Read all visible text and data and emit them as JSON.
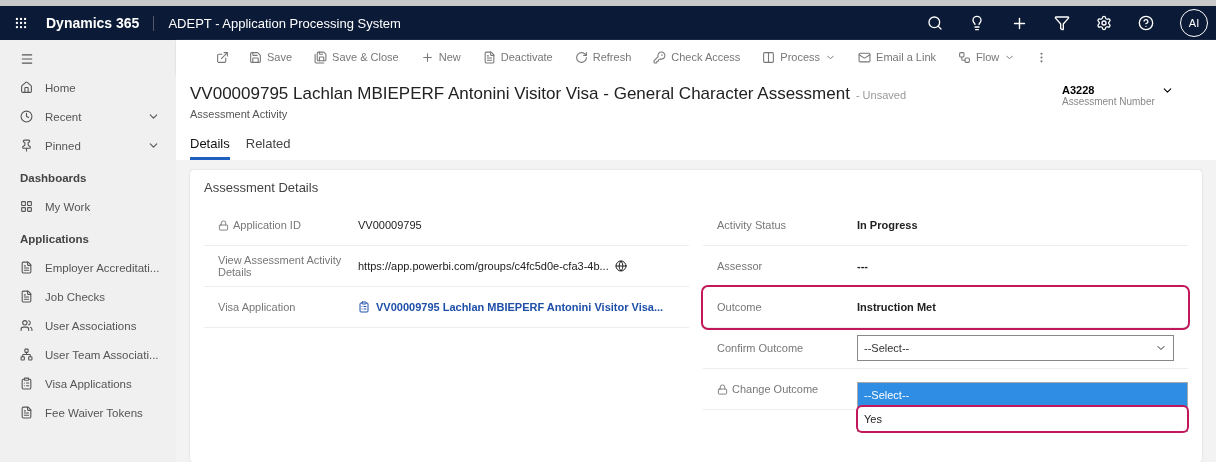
{
  "app_bar": {
    "product": "Dynamics 365",
    "app_name": "ADEPT - Application Processing System",
    "avatar": "AI"
  },
  "sidebar": {
    "items": [
      {
        "kind": "item",
        "label": "Home",
        "expandable": false
      },
      {
        "kind": "item",
        "label": "Recent",
        "expandable": true
      },
      {
        "kind": "item",
        "label": "Pinned",
        "expandable": true
      },
      {
        "kind": "heading",
        "label": "Dashboards"
      },
      {
        "kind": "item",
        "label": "My Work",
        "expandable": false
      },
      {
        "kind": "heading",
        "label": "Applications"
      },
      {
        "kind": "item",
        "label": "Employer Accreditati...",
        "expandable": false
      },
      {
        "kind": "item",
        "label": "Job Checks",
        "expandable": false
      },
      {
        "kind": "item",
        "label": "User Associations",
        "expandable": false
      },
      {
        "kind": "item",
        "label": "User Team Associati...",
        "expandable": false
      },
      {
        "kind": "item",
        "label": "Visa Applications",
        "expandable": false
      },
      {
        "kind": "item",
        "label": "Fee Waiver Tokens",
        "expandable": false
      }
    ]
  },
  "command_bar": [
    {
      "kind": "icon"
    },
    {
      "kind": "button",
      "label": "Save",
      "menu": false
    },
    {
      "kind": "button",
      "label": "Save & Close",
      "menu": false
    },
    {
      "kind": "button",
      "label": "New",
      "menu": false
    },
    {
      "kind": "button",
      "label": "Deactivate",
      "menu": false
    },
    {
      "kind": "button",
      "label": "Refresh",
      "menu": false
    },
    {
      "kind": "button",
      "label": "Check Access",
      "menu": false
    },
    {
      "kind": "button",
      "label": "Process",
      "menu": true
    },
    {
      "kind": "button",
      "label": "Email a Link",
      "menu": false
    },
    {
      "kind": "button",
      "label": "Flow",
      "menu": true
    },
    {
      "kind": "icon"
    }
  ],
  "record": {
    "title": "VV00009795 Lachlan MBIEPERF Antonini Visitor Visa - General Character Assessment",
    "save_state": "- Unsaved",
    "entity": "Assessment Activity",
    "header_value": "A3228",
    "header_label": "Assessment Number"
  },
  "tabs": [
    {
      "label": "Details",
      "selected": true
    },
    {
      "label": "Related",
      "selected": false
    }
  ],
  "section": {
    "title": "Assessment Details",
    "left_fields": [
      {
        "kind": "text",
        "label": "Application ID",
        "value": "VV00009795",
        "locked": true
      },
      {
        "kind": "url",
        "label": "View Assessment Activity Details",
        "value": "https://app.powerbi.com/groups/c4fc5d0e-cfa3-4b...",
        "locked": false
      },
      {
        "kind": "lookup",
        "label": "Visa Application",
        "value": "VV00009795 Lachlan MBIEPERF Antonini Visitor Visa...",
        "locked": false
      }
    ],
    "right_fields": [
      {
        "kind": "text",
        "label": "Activity Status",
        "value": "In Progress",
        "locked": false,
        "highlighted": false
      },
      {
        "kind": "text",
        "label": "Assessor",
        "value": "---",
        "locked": false,
        "highlighted": false
      },
      {
        "kind": "text",
        "label": "Outcome",
        "value": "Instruction Met",
        "locked": false,
        "highlighted": true
      },
      {
        "kind": "select",
        "label": "Confirm Outcome",
        "value": "--Select--",
        "locked": false,
        "highlighted": false,
        "options": [
          {
            "label": "--Select--",
            "selected": true,
            "highlighted": false
          },
          {
            "label": "Yes",
            "selected": false,
            "highlighted": true
          }
        ]
      },
      {
        "kind": "empty",
        "label": "Change Outcome",
        "locked": true,
        "highlighted": false
      }
    ]
  }
}
